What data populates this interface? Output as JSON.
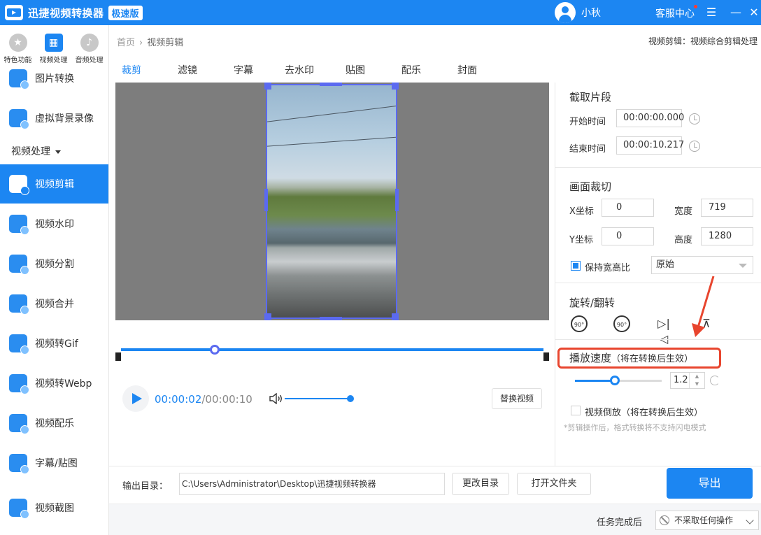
{
  "app": {
    "title": "迅捷视频转换器",
    "edition": "极速版",
    "username": "小秋",
    "service": "客服中心",
    "accent_color": "#1c86f2"
  },
  "window": {
    "menu_icon": "☰",
    "minimize_icon": "—",
    "close_icon": "✕"
  },
  "categories": [
    {
      "label": "特色功能",
      "icon": "star-icon",
      "active": false
    },
    {
      "label": "视频处理",
      "icon": "video-icon",
      "active": true
    },
    {
      "label": "音频处理",
      "icon": "music-icon",
      "active": false
    }
  ],
  "sidebar": {
    "items": [
      {
        "label": "图片转换",
        "icon": "image-convert-icon"
      },
      {
        "label": "虚拟背景录像",
        "icon": "virtual-background-icon"
      },
      {
        "label": "视频剪辑",
        "icon": "video-edit-icon"
      },
      {
        "label": "视频水印",
        "icon": "watermark-icon"
      },
      {
        "label": "视频分割",
        "icon": "split-icon"
      },
      {
        "label": "视频合并",
        "icon": "merge-icon"
      },
      {
        "label": "视频转Gif",
        "icon": "gif-icon"
      },
      {
        "label": "视频转Webp",
        "icon": "webp-icon"
      },
      {
        "label": "视频配乐",
        "icon": "music-note-icon"
      },
      {
        "label": "字幕/贴图",
        "icon": "star-sticker-icon"
      },
      {
        "label": "视频截图",
        "icon": "screenshot-icon"
      }
    ],
    "section_header": "视频处理"
  },
  "breadcrumb": {
    "home": "首页",
    "separator": "›",
    "current": "视频剪辑"
  },
  "page_description": "视频剪辑：视频综合剪辑处理",
  "tabs": [
    {
      "label": "裁剪",
      "active": true
    },
    {
      "label": "滤镜",
      "active": false
    },
    {
      "label": "字幕",
      "active": false
    },
    {
      "label": "去水印",
      "active": false
    },
    {
      "label": "贴图",
      "active": false
    },
    {
      "label": "配乐",
      "active": false
    },
    {
      "label": "封面",
      "active": false
    }
  ],
  "player": {
    "current_time": "00:00:02",
    "total_time": "/00:00:10",
    "replace_button": "替换视频"
  },
  "clip": {
    "title": "截取片段",
    "start_label": "开始时间",
    "start_value": "00:00:00.000",
    "end_label": "结束时间",
    "end_value": "00:00:10.217"
  },
  "crop": {
    "title": "画面裁切",
    "x_label": "X坐标",
    "x_value": "0",
    "y_label": "Y坐标",
    "y_value": "0",
    "width_label": "宽度",
    "width_value": "719",
    "height_label": "高度",
    "height_value": "1280",
    "keep_ratio_label": "保持宽高比",
    "keep_ratio_checked": true,
    "ratio_value": "原始"
  },
  "rotate": {
    "title": "旋转/翻转",
    "rotate_left_label": "90°",
    "rotate_right_label": "90°"
  },
  "speed": {
    "title": "播放速度",
    "note": "（将在转换后生效）",
    "value": "1.2"
  },
  "reverse": {
    "label": "视频倒放",
    "note": "（将在转换后生效）",
    "checked": false
  },
  "notice": "*剪辑操作后，格式转换将不支持闪电模式",
  "output": {
    "label": "输出目录：",
    "path": "C:\\Users\\Administrator\\Desktop\\迅捷视频转换器",
    "change_dir_button": "更改目录",
    "open_folder_button": "打开文件夹",
    "export_button": "导出"
  },
  "task": {
    "label": "任务完成后",
    "value": "不采取任何操作"
  }
}
